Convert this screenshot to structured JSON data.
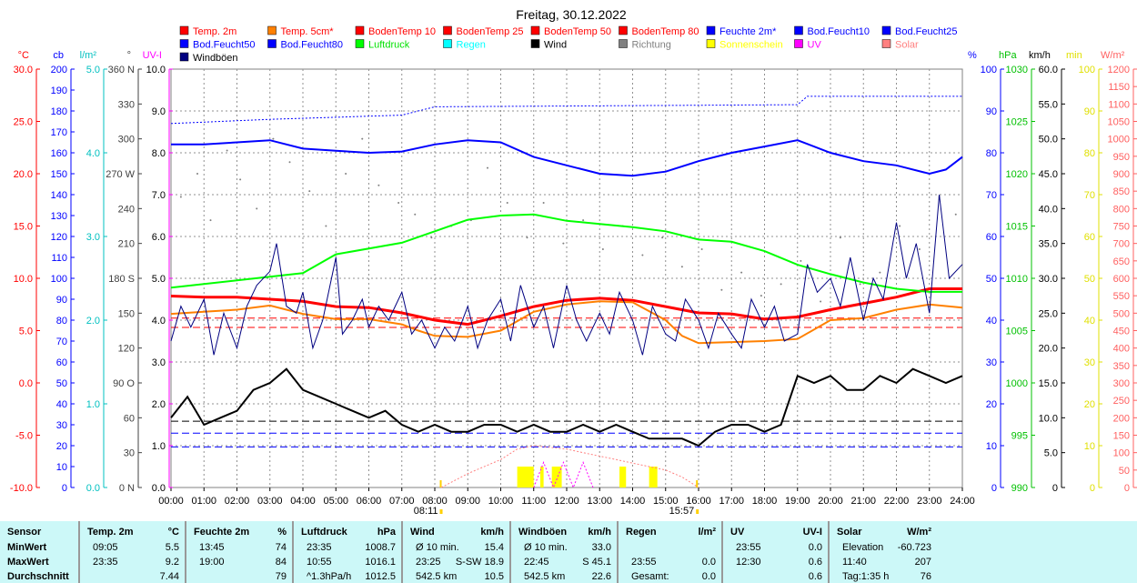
{
  "chart_data": {
    "type": "line",
    "title": "Freitag, 30.12.2022",
    "x_hours": [
      0,
      24
    ],
    "x_ticks": [
      "00:00",
      "01:00",
      "02:00",
      "03:00",
      "04:00",
      "05:00",
      "06:00",
      "07:00",
      "08:00",
      "09:00",
      "10:00",
      "11:00",
      "12:00",
      "13:00",
      "14:00",
      "15:00",
      "16:00",
      "17:00",
      "18:00",
      "19:00",
      "20:00",
      "21:00",
      "22:00",
      "23:00",
      "24:00"
    ],
    "sunrise": "08:11",
    "sunset": "15:57",
    "sunrise_h": 8.18,
    "sunset_h": 15.95,
    "legend": [
      {
        "label": "Temp. 2m",
        "color": "#ff0000",
        "text": "#ff0000"
      },
      {
        "label": "Temp. 5cm*",
        "color": "#ff8000",
        "text": "#ff0000"
      },
      {
        "label": "BodenTemp 10",
        "color": "#ff0000",
        "text": "#ff0000"
      },
      {
        "label": "BodenTemp 25",
        "color": "#ff0000",
        "text": "#ff0000"
      },
      {
        "label": "BodenTemp 50",
        "color": "#ff0000",
        "text": "#ff0000"
      },
      {
        "label": "BodenTemp 80",
        "color": "#ff0000",
        "text": "#ff0000"
      },
      {
        "label": "Feuchte 2m*",
        "color": "#0000ff",
        "text": "#0000ff"
      },
      {
        "label": "Bod.Feucht10",
        "color": "#0000ff",
        "text": "#0000ff"
      },
      {
        "label": "Bod.Feucht25",
        "color": "#0000ff",
        "text": "#0000ff"
      },
      {
        "label": "Bod.Feucht50",
        "color": "#0000ff",
        "text": "#0000ff"
      },
      {
        "label": "Bod.Feucht80",
        "color": "#0000ff",
        "text": "#0000ff"
      },
      {
        "label": "Luftdruck",
        "color": "#00ff00",
        "text": "#00e000"
      },
      {
        "label": "Regen",
        "color": "#00ffff",
        "text": "#00ffff"
      },
      {
        "label": "Wind",
        "color": "#000000",
        "text": "#000000"
      },
      {
        "label": "Richtung",
        "color": "#808080",
        "text": "#808080"
      },
      {
        "label": "Sonnenschein",
        "color": "#ffff00",
        "text": "#ffff00"
      },
      {
        "label": "UV",
        "color": "#ff00ff",
        "text": "#ff00ff"
      },
      {
        "label": "Solar",
        "color": "#ff8080",
        "text": "#ff8080"
      },
      {
        "label": "Windböen",
        "color": "#000080",
        "text": "#000000"
      }
    ],
    "axes_left": [
      {
        "unit": "°C",
        "color": "#ff0000",
        "labels": [
          "30.0",
          "25.0",
          "20.0",
          "15.0",
          "10.0",
          "5.0",
          "0.0",
          "-5.0",
          "-10.0"
        ]
      },
      {
        "unit": "cb",
        "color": "#0000ff",
        "labels": [
          "200",
          "190",
          "180",
          "170",
          "160",
          "150",
          "140",
          "130",
          "120",
          "110",
          "100",
          "90",
          "80",
          "70",
          "60",
          "50",
          "40",
          "30",
          "20",
          "10",
          "0"
        ]
      },
      {
        "unit": "l/m²",
        "color": "#00c0c0",
        "labels": [
          "5.0",
          "4.0",
          "3.0",
          "2.0",
          "1.0",
          "0.0"
        ]
      },
      {
        "unit": "°",
        "color": "#404040",
        "labels": [
          "360 N",
          "330",
          "300",
          "270 W",
          "240",
          "210",
          "180 S",
          "150",
          "120",
          "90  O",
          "60",
          "30",
          "0  N"
        ]
      },
      {
        "unit": "UV-I",
        "color": "#ff00ff",
        "labels": [
          "10.0",
          "9.0",
          "8.0",
          "7.0",
          "6.0",
          "5.0",
          "4.0",
          "3.0",
          "2.0",
          "1.0",
          "0.0"
        ]
      }
    ],
    "axes_right": [
      {
        "unit": "%",
        "color": "#0000ff",
        "labels": [
          "100",
          "90",
          "80",
          "70",
          "60",
          "50",
          "40",
          "30",
          "20",
          "10",
          "0"
        ]
      },
      {
        "unit": "hPa",
        "color": "#00c000",
        "labels": [
          "1030",
          "1025",
          "1020",
          "1015",
          "1010",
          "1005",
          "1000",
          "995",
          "990"
        ]
      },
      {
        "unit": "km/h",
        "color": "#000000",
        "labels": [
          "60.0",
          "55.0",
          "50.0",
          "45.0",
          "40.0",
          "35.0",
          "30.0",
          "25.0",
          "20.0",
          "15.0",
          "10.0",
          "5.0",
          "0"
        ]
      },
      {
        "unit": "min",
        "color": "#e0e000",
        "labels": [
          "100",
          "90",
          "80",
          "70",
          "60",
          "50",
          "40",
          "30",
          "20",
          "10",
          "0"
        ]
      },
      {
        "unit": "W/m²",
        "color": "#ff6060",
        "labels": [
          "1200",
          "1150",
          "1100",
          "1050",
          "1000",
          "950",
          "900",
          "850",
          "800",
          "750",
          "700",
          "650",
          "600",
          "550",
          "500",
          "450",
          "400",
          "350",
          "300",
          "250",
          "200",
          "150",
          "100",
          "50",
          "0"
        ]
      }
    ],
    "series": [
      {
        "name": "Temp. 2m",
        "unit": "°C",
        "color": "#ff0000",
        "width": 3,
        "x": [
          0,
          1,
          2,
          3,
          4,
          5,
          6,
          7,
          8,
          9,
          10,
          11,
          12,
          13,
          14,
          15,
          16,
          17,
          18,
          19,
          20,
          21,
          22,
          23,
          24
        ],
        "values": [
          8.3,
          8.2,
          8.2,
          8.0,
          7.8,
          7.3,
          7.2,
          6.7,
          6.0,
          5.6,
          6.4,
          7.3,
          7.9,
          8.1,
          7.9,
          7.3,
          6.7,
          6.6,
          6.1,
          6.3,
          7.0,
          7.6,
          8.2,
          9.0,
          9.0
        ]
      },
      {
        "name": "Temp. 5cm*",
        "unit": "°C",
        "color": "#ff8000",
        "width": 2,
        "x": [
          0,
          1,
          2,
          3,
          4,
          5,
          6,
          7,
          7.5,
          8,
          9,
          10,
          11,
          12,
          13,
          14,
          15,
          15.5,
          16,
          17,
          18,
          19,
          20,
          21,
          22,
          23,
          24
        ],
        "values": [
          6.6,
          6.8,
          7.0,
          7.4,
          6.6,
          6.1,
          6.1,
          5.6,
          5.0,
          4.5,
          4.4,
          5.0,
          6.8,
          7.5,
          7.8,
          7.7,
          6.0,
          4.5,
          3.8,
          3.9,
          4.0,
          4.2,
          6.0,
          6.2,
          7.0,
          7.5,
          7.2
        ]
      },
      {
        "name": "Feuchte 2m*",
        "unit": "%",
        "color": "#0000ff",
        "width": 2,
        "x": [
          0,
          1,
          2,
          3,
          4,
          5,
          6,
          7,
          8,
          9,
          10,
          11,
          12,
          13,
          14,
          15,
          16,
          17,
          18,
          19,
          20,
          21,
          22,
          23,
          23.5,
          24
        ],
        "values": [
          82,
          82,
          82.5,
          83,
          81,
          80.5,
          80,
          80.3,
          82,
          83,
          82.5,
          79,
          77,
          75,
          74.5,
          75.5,
          78,
          80,
          81.5,
          83,
          80,
          78,
          77,
          75,
          76,
          79
        ]
      },
      {
        "name": "Feuchte upper",
        "unit": "%",
        "color": "#0000ff",
        "width": 1,
        "dash": "2,2",
        "x": [
          0,
          3,
          5,
          7,
          8,
          19,
          19.3,
          24
        ],
        "values": [
          87,
          88,
          88.5,
          89,
          91,
          91.5,
          93.5,
          93.5
        ]
      },
      {
        "name": "Luftdruck",
        "unit": "hPa",
        "color": "#00ff00",
        "width": 2,
        "x": [
          0,
          2,
          4,
          5,
          7,
          8,
          9,
          10,
          11,
          12,
          13,
          14,
          15,
          16,
          17,
          18,
          19,
          20,
          21,
          22,
          23,
          24
        ],
        "values": [
          1009.1,
          1009.8,
          1010.5,
          1012.3,
          1013.4,
          1014.5,
          1015.6,
          1016,
          1016.1,
          1015.5,
          1015.2,
          1014.9,
          1014.5,
          1013.7,
          1013.5,
          1012.6,
          1011.3,
          1010.4,
          1009.6,
          1009,
          1008.7,
          1008.7
        ]
      },
      {
        "name": "Wind",
        "unit": "km/h",
        "color": "#000000",
        "width": 2,
        "x": [
          0,
          0.5,
          1,
          1.5,
          2,
          2.5,
          3,
          3.5,
          4,
          4.5,
          5,
          5.5,
          6,
          6.5,
          7,
          7.5,
          8,
          8.5,
          9,
          9.5,
          10,
          10.5,
          11,
          11.5,
          12,
          12.5,
          13,
          13.5,
          14,
          14.5,
          15,
          15.5,
          16,
          16.5,
          17,
          17.5,
          18,
          18.5,
          19,
          19.5,
          20,
          20.5,
          21,
          21.5,
          22,
          22.5,
          23,
          23.5,
          24
        ],
        "values": [
          10,
          13,
          9,
          10,
          11,
          14,
          15,
          17,
          14,
          13,
          12,
          11,
          10,
          11,
          9,
          8,
          9,
          8,
          8,
          9,
          9,
          8,
          9,
          8,
          8,
          9,
          8,
          9,
          8,
          7,
          7,
          7,
          6,
          8,
          9,
          9,
          8,
          9,
          16,
          15,
          16,
          14,
          14,
          16,
          15,
          17,
          16,
          15,
          16
        ]
      },
      {
        "name": "Windböen",
        "unit": "km/h",
        "color": "#000080",
        "width": 1,
        "x": [
          0,
          0.3,
          0.6,
          1,
          1.3,
          1.6,
          2,
          2.3,
          2.6,
          3,
          3.2,
          3.5,
          3.8,
          4,
          4.3,
          4.6,
          5,
          5.2,
          5.5,
          5.8,
          6,
          6.3,
          6.6,
          7,
          7.3,
          7.6,
          8,
          8.3,
          8.6,
          9,
          9.3,
          9.6,
          10,
          10.3,
          10.6,
          11,
          11.3,
          11.6,
          12,
          12.3,
          12.6,
          13,
          13.3,
          13.6,
          14,
          14.3,
          14.6,
          15,
          15.3,
          15.6,
          16,
          16.3,
          16.6,
          17,
          17.3,
          17.6,
          18,
          18.3,
          18.6,
          19,
          19.3,
          19.6,
          20,
          20.3,
          20.6,
          21,
          21.3,
          21.6,
          22,
          22.3,
          22.6,
          23,
          23.3,
          23.6,
          24
        ],
        "values": [
          21,
          26,
          23,
          27,
          19,
          25,
          20,
          26,
          29,
          31,
          35,
          26,
          25,
          28,
          20,
          24,
          33,
          22,
          24,
          27,
          23,
          26,
          24,
          28,
          22,
          24,
          20,
          23,
          21,
          26,
          20,
          24,
          27,
          21,
          29,
          23,
          26,
          20,
          29,
          24,
          21,
          25,
          22,
          28,
          24,
          19,
          26,
          22,
          21,
          27,
          24,
          20,
          25,
          22,
          20,
          27,
          23,
          26,
          21,
          22,
          32,
          28,
          30,
          26,
          33,
          24,
          30,
          27,
          38,
          30,
          35,
          25,
          42,
          30,
          32
        ]
      },
      {
        "name": "Solar",
        "unit": "W/m²",
        "color": "#ff8080",
        "width": 1,
        "dash": "2,2",
        "x": [
          8.2,
          9,
          10,
          10.5,
          11,
          11.5,
          12,
          12.5,
          13,
          13.5,
          14,
          14.5,
          15,
          15.5,
          16
        ],
        "values": [
          0,
          40,
          80,
          110,
          120,
          115,
          110,
          100,
          90,
          80,
          70,
          60,
          50,
          30,
          0
        ]
      },
      {
        "name": "UV",
        "unit": "UV-I",
        "color": "#ff00ff",
        "width": 1,
        "dash": "2,2",
        "x": [
          11,
          11.3,
          11.6,
          11.9,
          12.2,
          12.5,
          12.8
        ],
        "values": [
          0,
          0.6,
          0,
          0.6,
          0,
          0.6,
          0
        ]
      }
    ],
    "sunshine": {
      "unit": "min",
      "color": "#ffff00",
      "bars": [
        [
          10.5,
          11.0,
          5
        ],
        [
          11.2,
          11.3,
          5
        ],
        [
          11.55,
          11.85,
          5
        ],
        [
          13.6,
          13.8,
          5
        ],
        [
          14.5,
          14.75,
          5
        ]
      ]
    },
    "direction": {
      "unit": "°",
      "color": "#808080",
      "x": [
        0.3,
        0.8,
        1.2,
        1.7,
        2.1,
        2.6,
        3.1,
        3.6,
        4.2,
        4.7,
        5.3,
        5.8,
        6.3,
        6.9,
        7.4,
        7.9,
        8.5,
        9.1,
        9.6,
        10.2,
        10.8,
        11.3,
        11.9,
        12.5,
        13.1,
        13.7,
        14.3,
        14.9,
        15.5,
        16.1,
        16.7,
        17.3,
        17.9,
        18.5,
        19.1,
        19.7,
        20.3,
        20.9,
        21.5,
        22.1,
        22.7,
        23.3,
        23.8
      ],
      "values": [
        250,
        270,
        230,
        290,
        265,
        240,
        300,
        280,
        255,
        225,
        270,
        300,
        260,
        245,
        235,
        215,
        225,
        230,
        275,
        245,
        215,
        245,
        210,
        230,
        205,
        225,
        200,
        215,
        190,
        205,
        170,
        185,
        165,
        175,
        195,
        160,
        215,
        175,
        185,
        225,
        205,
        250,
        235
      ]
    },
    "ref_lines": [
      {
        "unit": "°C",
        "value": 6.2,
        "color": "#ff0000"
      },
      {
        "unit": "°C",
        "value": 5.3,
        "color": "#ff0000"
      },
      {
        "unit": "km/h",
        "value": 9.5,
        "color": "#000000"
      },
      {
        "unit": "%",
        "value": 13,
        "color": "#0000ff"
      },
      {
        "unit": "%",
        "value": 9.7,
        "color": "#0000ff"
      }
    ]
  },
  "table": {
    "cols": [
      {
        "h": [
          "Sensor",
          ""
        ],
        "rows": [
          [
            "MinWert",
            ""
          ],
          [
            "MaxWert",
            ""
          ],
          [
            "Durchschnitt",
            ""
          ]
        ],
        "bold": true
      },
      {
        "h": [
          "Temp. 2m",
          "°C"
        ],
        "rows": [
          [
            "09:05",
            "5.5"
          ],
          [
            "23:35",
            "9.2"
          ],
          [
            "",
            "7.44"
          ]
        ]
      },
      {
        "h": [
          "Feuchte 2m",
          "%"
        ],
        "rows": [
          [
            "13:45",
            "74"
          ],
          [
            "19:00",
            "84"
          ],
          [
            "",
            "79"
          ]
        ]
      },
      {
        "h": [
          "Luftdruck",
          "hPa"
        ],
        "rows": [
          [
            "23:35",
            "1008.7"
          ],
          [
            "10:55",
            "1016.1"
          ],
          [
            "^1.3hPa/h",
            "1012.5"
          ]
        ]
      },
      {
        "h": [
          "Wind",
          "km/h"
        ],
        "rows": [
          [
            "Ø 10 min.",
            "15.4"
          ],
          [
            "23:25",
            "S-SW 18.9"
          ],
          [
            "542.5 km",
            "10.5"
          ]
        ]
      },
      {
        "h": [
          "Windböen",
          "km/h"
        ],
        "rows": [
          [
            "Ø 10 min.",
            "33.0"
          ],
          [
            "22:45",
            "S 45.1"
          ],
          [
            "542.5 km",
            "22.6"
          ]
        ]
      },
      {
        "h": [
          "Regen",
          "l/m²"
        ],
        "rows": [
          [
            "",
            ""
          ],
          [
            "23:55",
            "0.0"
          ],
          [
            "Gesamt:",
            "0.0"
          ]
        ]
      },
      {
        "h": [
          "UV",
          "UV-I"
        ],
        "rows": [
          [
            "23:55",
            "0.0"
          ],
          [
            "12:30",
            "0.6"
          ],
          [
            "",
            "0.6"
          ]
        ]
      },
      {
        "h": [
          "Solar",
          "W/m²"
        ],
        "rows": [
          [
            "Elevation",
            "-60.723"
          ],
          [
            "11:40",
            "207"
          ],
          [
            "Tag:1:35 h",
            "76"
          ]
        ]
      }
    ]
  }
}
